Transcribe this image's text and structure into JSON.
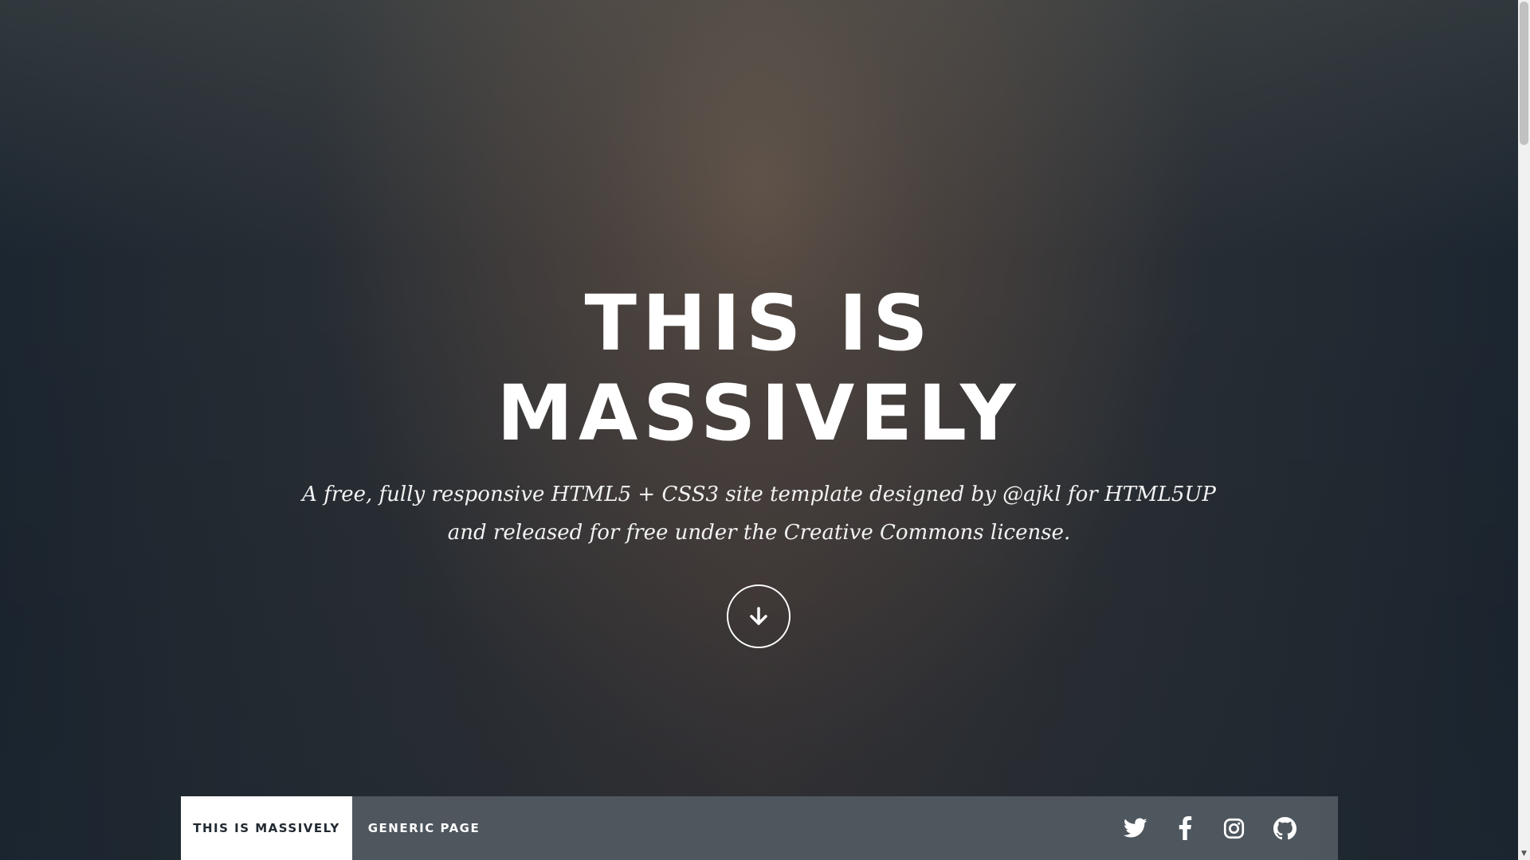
{
  "hero": {
    "title_line1": "THIS IS",
    "title_line2": "MASSIVELY",
    "subtitle_line1": "A free, fully responsive HTML5 + CSS3 site template designed by @ajkl for HTML5UP",
    "subtitle_line2": "and released for free under the Creative Commons license.",
    "scroll_icon": "arrow-down-icon"
  },
  "nav": {
    "items": [
      {
        "label": "THIS IS MASSIVELY",
        "active": true
      },
      {
        "label": "GENERIC PAGE",
        "active": false
      }
    ],
    "social": [
      "twitter-icon",
      "facebook-icon",
      "instagram-icon",
      "github-icon"
    ]
  },
  "colors": {
    "text": "#ffffff",
    "nav_active_bg": "#ffffff",
    "nav_active_text": "#212931",
    "nav_bg": "#525a62"
  }
}
